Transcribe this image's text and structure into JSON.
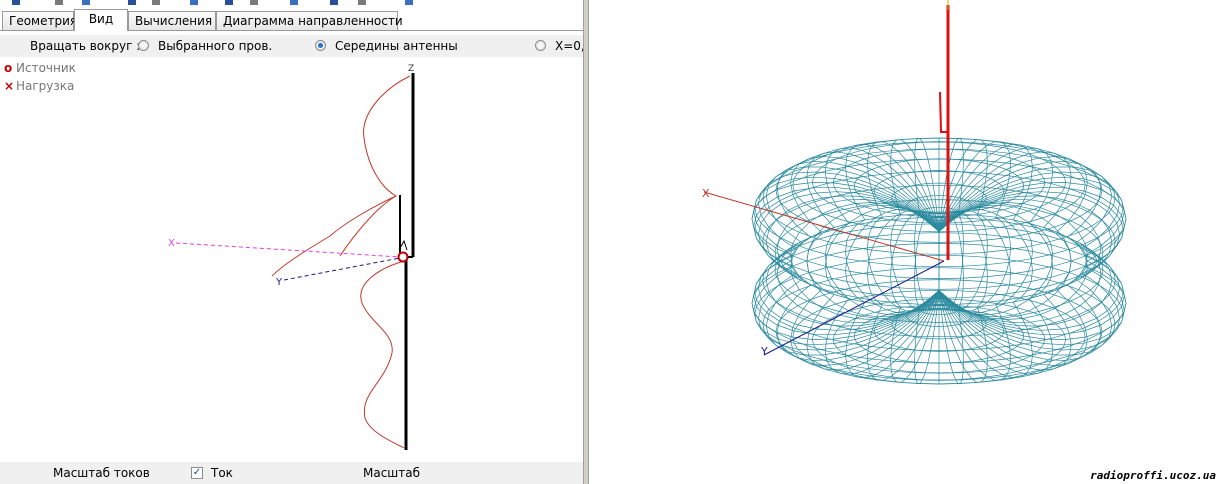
{
  "tabs": [
    {
      "label": "Геометрия",
      "active": false
    },
    {
      "label": "Вид",
      "active": true
    },
    {
      "label": "Вычисления",
      "active": false
    },
    {
      "label": "Диаграмма направленности",
      "active": false
    }
  ],
  "rotate": {
    "label": "Вращать вокруг :",
    "options": [
      {
        "label": "Выбранного пров.",
        "checked": false
      },
      {
        "label": "Середины антенны",
        "checked": true
      },
      {
        "label": "X=0,",
        "checked": false
      }
    ]
  },
  "legend": {
    "source": "Источник",
    "load": "Нагрузка"
  },
  "axis_labels": {
    "x": "X",
    "y": "Y",
    "z": "Z"
  },
  "bottom": {
    "current_scale": "Масштаб токов",
    "current_checkbox": "Ток",
    "current_checked": true,
    "scale": "Масштаб"
  },
  "watermark": "radioproffi.ucoz.ua",
  "colors": {
    "wireframe": "#2b8a9e",
    "feed_line": "#dd1111",
    "current": "#c0392b",
    "x_axis": "#e040e0",
    "y_axis": "#1a1a8a"
  },
  "icons": [
    "toolbar-icon-1",
    "toolbar-icon-2",
    "toolbar-icon-3",
    "toolbar-icon-4",
    "toolbar-icon-5",
    "toolbar-icon-6",
    "toolbar-icon-7",
    "toolbar-icon-8",
    "toolbar-icon-9",
    "toolbar-icon-10",
    "toolbar-icon-11",
    "toolbar-icon-12"
  ]
}
